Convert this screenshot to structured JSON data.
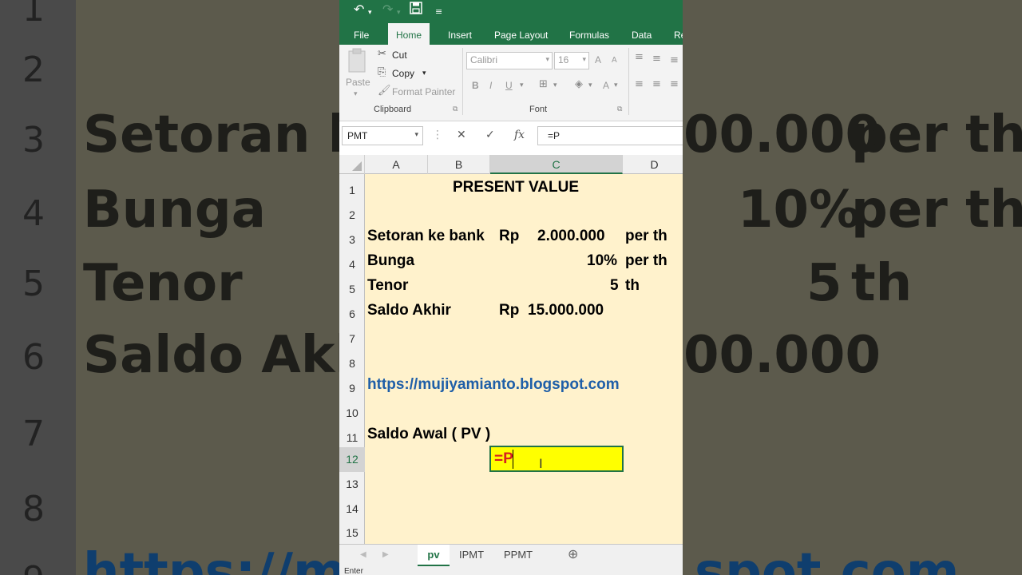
{
  "background": {
    "row_numbers": [
      "1",
      "2",
      "3",
      "4",
      "5",
      "6",
      "7",
      "8",
      "9"
    ],
    "texts": {
      "r3_label": "Setoran ke",
      "r3_value": "00.000",
      "r3_unit": "per th",
      "r4_label": "Bunga",
      "r4_value": "10%",
      "r4_unit": "per th",
      "r5_label": "Tenor",
      "r5_value": "5",
      "r5_unit": "th",
      "r6_label": "Saldo Akhir",
      "r6_value": "00.000",
      "r9_link": "https://mu",
      "r9_link_tail": "spot.com"
    }
  },
  "qat": {
    "undo": "↶",
    "redo": "↷",
    "save": "💾",
    "customize": "⇩"
  },
  "tabs": [
    {
      "label": "File"
    },
    {
      "label": "Home"
    },
    {
      "label": "Insert"
    },
    {
      "label": "Page Layout"
    },
    {
      "label": "Formulas"
    },
    {
      "label": "Data"
    },
    {
      "label": "Re"
    }
  ],
  "ribbon": {
    "clipboard": {
      "paste": "Paste",
      "cut": "Cut",
      "copy": "Copy",
      "format_painter": "Format Painter",
      "label": "Clipboard"
    },
    "font": {
      "name": "Calibri",
      "size": "16",
      "bold": "B",
      "italic": "I",
      "underline": "U",
      "grow": "A",
      "shrink": "A",
      "font_color": "A",
      "label": "Font"
    }
  },
  "formula_bar": {
    "name_box": "PMT",
    "cancel": "✕",
    "enter": "✓",
    "fx": "fx",
    "content": "=P"
  },
  "columns": [
    "A",
    "B",
    "C",
    "D"
  ],
  "rows": [
    "1",
    "2",
    "3",
    "4",
    "5",
    "6",
    "7",
    "8",
    "9",
    "10",
    "11",
    "12",
    "13",
    "14",
    "15"
  ],
  "cells": {
    "title": "PRESENT  VALUE",
    "r3_label": "Setoran ke bank",
    "r3_rp": "Rp",
    "r3_value": "2.000.000",
    "r3_unit": "per th",
    "r4_label": "Bunga",
    "r4_value": "10%",
    "r4_unit": "per th",
    "r5_label": "Tenor",
    "r5_value": "5",
    "r5_unit": "th",
    "r6_label": "Saldo Akhir",
    "r6_rp": "Rp",
    "r6_value": "15.000.000",
    "r9_link": "https://mujiyamianto.blogspot.com",
    "r11_label": "Saldo Awal ( PV )",
    "active_value": "=P"
  },
  "sheet_tabs": [
    {
      "label": "pv"
    },
    {
      "label": "IPMT"
    },
    {
      "label": "PPMT"
    }
  ],
  "add_sheet": "⊕",
  "status": {
    "mode": "Enter"
  },
  "colors": {
    "excel_green": "#217346",
    "sheet_fill": "#fff2cc",
    "active_fill": "#ffff00",
    "link_blue": "#1f5fa8",
    "entry_red": "#d62020"
  }
}
